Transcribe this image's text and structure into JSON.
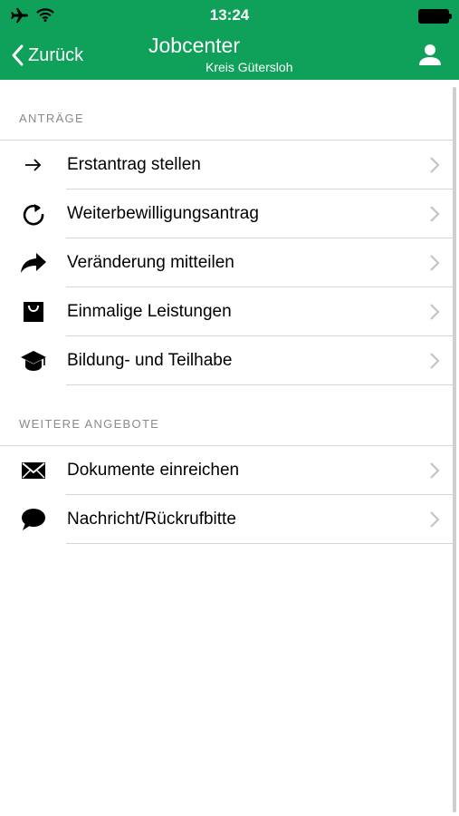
{
  "status_bar": {
    "time": "13:24"
  },
  "nav": {
    "back_label": "Zurück",
    "title": "Jobcenter",
    "subtitle": "Kreis Gütersloh"
  },
  "sections": [
    {
      "header": "ANTRÄGE",
      "items": [
        {
          "label": "Erstantrag stellen",
          "icon": "arrow-right-icon"
        },
        {
          "label": "Weiterbewilligungsantrag",
          "icon": "refresh-icon"
        },
        {
          "label": "Veränderung mitteilen",
          "icon": "share-arrow-icon"
        },
        {
          "label": "Einmalige Leistungen",
          "icon": "shopping-bag-icon"
        },
        {
          "label": "Bildung- und Teilhabe",
          "icon": "graduation-cap-icon"
        }
      ]
    },
    {
      "header": "WEITERE ANGEBOTE",
      "items": [
        {
          "label": "Dokumente einreichen",
          "icon": "envelope-icon"
        },
        {
          "label": "Nachricht/Rückrufbitte",
          "icon": "speech-bubble-icon"
        }
      ]
    }
  ],
  "colors": {
    "accent": "#0fa05a",
    "divider": "#d6d6d6",
    "section_header": "#8a8a8f"
  }
}
